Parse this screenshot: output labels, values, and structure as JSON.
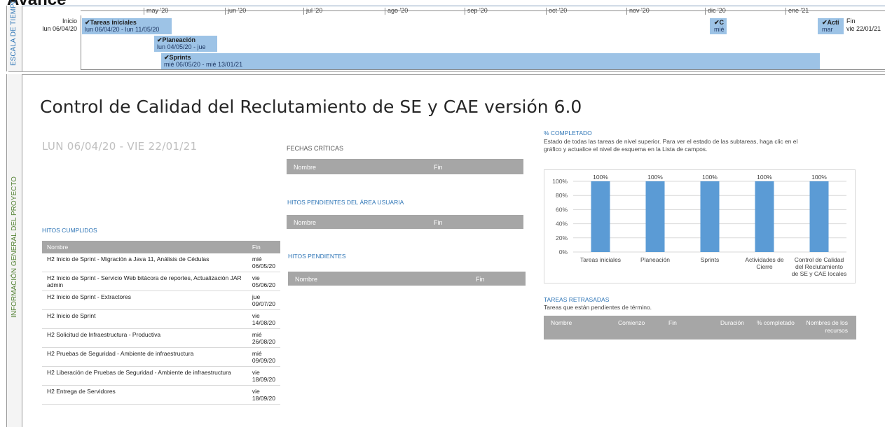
{
  "top_title": "Avance",
  "timeline": {
    "side_label": "ESCALA DE TIEMPO",
    "start_label": "Inicio",
    "start_date": "lun 06/04/20",
    "end_label": "Fin",
    "end_date": "vie 22/01/21",
    "months": [
      "may '20",
      "jun '20",
      "jul '20",
      "ago '20",
      "sep '20",
      "oct '20",
      "nov '20",
      "dic '20",
      "ene '21"
    ],
    "bars": [
      {
        "name": "✔Tareas iniciales",
        "dates": "lun 06/04/20 - lun 11/05/20"
      },
      {
        "name": "✔Planeación",
        "dates": "lun 04/05/20 - jue"
      },
      {
        "name": "✔Sprints",
        "dates": "mié 06/05/20 - mié 13/01/21"
      },
      {
        "name": "✔C",
        "dates": "mié"
      },
      {
        "name": "✔Acti",
        "dates": "mar"
      }
    ]
  },
  "side_label": "INFORMACIÓN GENERAL DEL PROYECTO",
  "report_title": "Control de Calidad del Reclutamiento de SE y CAE versión 6.0",
  "date_range": "LUN 06/04/20 -  VIE 22/01/21",
  "hitos_cumplidos": {
    "title": "HITOS CUMPLIDOS",
    "col_nombre": "Nombre",
    "col_fin": "Fin",
    "rows": [
      {
        "nombre": "H2 Inicio de Sprint - Migración a Java 11, Análisis de Cédulas",
        "fin1": "mié",
        "fin2": "06/05/20"
      },
      {
        "nombre": "H2 Inicio de Sprint - Servicio Web bitácora de reportes, Actualización JAR admin",
        "fin1": "vie",
        "fin2": "05/06/20"
      },
      {
        "nombre": "H2 Inicio de Sprint - Extractores",
        "fin1": "jue",
        "fin2": "09/07/20"
      },
      {
        "nombre": "H2 Inicio de Sprint",
        "fin1": "vie",
        "fin2": "14/08/20"
      },
      {
        "nombre": "H2 Solicitud de Infraestructura - Productiva",
        "fin1": "mié",
        "fin2": "26/08/20"
      },
      {
        "nombre": "H2 Pruebas de Seguridad - Ambiente de infraestructura",
        "fin1": "mié",
        "fin2": "09/09/20"
      },
      {
        "nombre": "H2 Liberación de Pruebas de Seguridad - Ambiente de infraestructura",
        "fin1": "vie",
        "fin2": "18/09/20"
      },
      {
        "nombre": "H2 Entrega de Servidores",
        "fin1": "vie",
        "fin2": "18/09/20"
      }
    ]
  },
  "fechas_criticas": {
    "title": "FECHAS CRÍTICAS",
    "col_nombre": "Nombre",
    "col_fin": "Fin"
  },
  "hitos_area_usuaria": {
    "title": "HITOS PENDIENTES DEL ÁREA USUARIA",
    "col_nombre": "Nombre",
    "col_fin": "Fin"
  },
  "hitos_pendientes": {
    "title": "HITOS PENDIENTES",
    "col_nombre": "Nombre",
    "col_fin": "Fin"
  },
  "completado": {
    "title": "% COMPLETADO",
    "desc_line1": "Estado de todas las tareas de nivel superior. Para ver el estado de las subtareas, haga clic en el",
    "desc_line2": "gráfico y actualice el nivel de esquema en la Lista de campos."
  },
  "chart_data": {
    "type": "bar",
    "categories": [
      "Tareas iniciales",
      "Planeación",
      "Sprints",
      "Actividades de Cierre",
      "Control de Calidad del Reclutamiento de SE y CAE locales"
    ],
    "category_lines": [
      [
        "Tareas iniciales"
      ],
      [
        "Planeación"
      ],
      [
        "Sprints"
      ],
      [
        "Actividades de",
        "Cierre"
      ],
      [
        "Control de Calidad",
        "del Reclutamiento",
        "de SE y CAE locales"
      ]
    ],
    "values": [
      100,
      100,
      100,
      100,
      100
    ],
    "value_labels": [
      "100%",
      "100%",
      "100%",
      "100%",
      "100%"
    ],
    "yticks": [
      "0%",
      "20%",
      "40%",
      "60%",
      "80%",
      "100%"
    ],
    "ylim": [
      0,
      100
    ],
    "bar_color": "#5b9bd5",
    "grid": true
  },
  "tareas_retrasadas": {
    "title": "TAREAS RETRASADAS",
    "subtitle": "Tareas que están pendientes de término.",
    "cols": [
      "Nombre",
      "Comienzo",
      "Fin",
      "Duración",
      "% completado",
      "Nombres de los recursos"
    ]
  }
}
